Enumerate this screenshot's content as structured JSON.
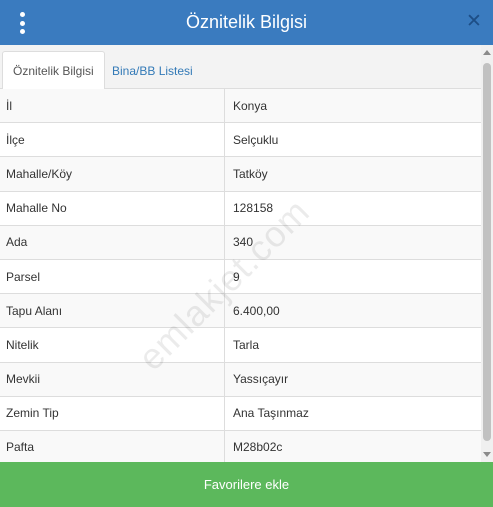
{
  "header": {
    "title": "Öznitelik Bilgisi",
    "menu_icon": "vertical-ellipsis-icon",
    "close_icon": "close-icon",
    "color": "#3a7bbf"
  },
  "tabs": [
    {
      "label": "Öznitelik Bilgisi",
      "active": true
    },
    {
      "label": "Bina/BB Listesi",
      "active": false
    }
  ],
  "attributes": [
    {
      "label": "İl",
      "value": "Konya"
    },
    {
      "label": "İlçe",
      "value": "Selçuklu"
    },
    {
      "label": "Mahalle/Köy",
      "value": "Tatköy"
    },
    {
      "label": "Mahalle No",
      "value": "128158"
    },
    {
      "label": "Ada",
      "value": "340"
    },
    {
      "label": "Parsel",
      "value": "9"
    },
    {
      "label": "Tapu Alanı",
      "value": "6.400,00"
    },
    {
      "label": "Nitelik",
      "value": "Tarla"
    },
    {
      "label": "Mevkii",
      "value": "Yassıçayır"
    },
    {
      "label": "Zemin Tip",
      "value": "Ana Taşınmaz"
    },
    {
      "label": "Pafta",
      "value": "M28b02c"
    }
  ],
  "watermark": "emlakjet.com",
  "footer": {
    "button_label": "Favorilere ekle",
    "color": "#5cb85c"
  }
}
